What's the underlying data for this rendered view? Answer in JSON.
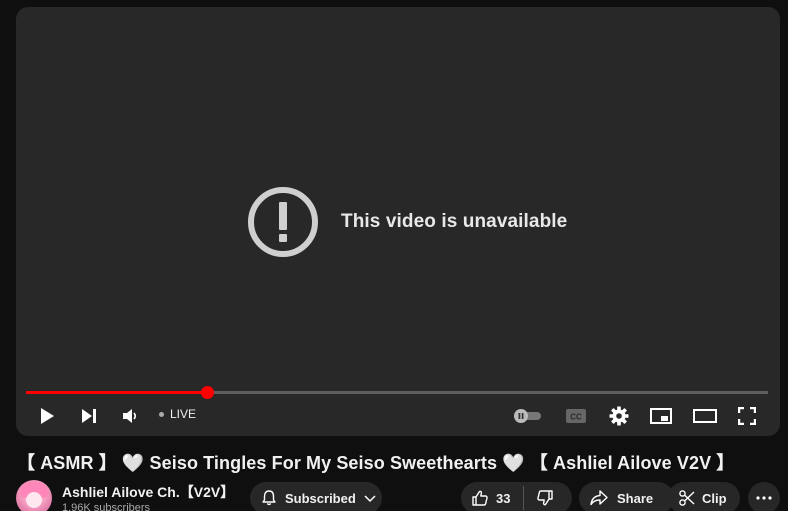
{
  "player": {
    "error_message": "This video is unavailable",
    "progress_fraction": 0.244,
    "live_label": "LIVE",
    "accent_color": "#ff0000"
  },
  "video": {
    "title": "【 ASMR 】 🤍 Seiso Tingles For My Seiso Sweethearts 🤍 【 Ashliel Ailove V2V 】"
  },
  "channel": {
    "name": "Ashliel Ailove Ch.【V2V】",
    "subscribers": "1.96K subscribers"
  },
  "actions": {
    "subscribed_label": "Subscribed",
    "like_count": "33",
    "share_label": "Share",
    "clip_label": "Clip"
  },
  "icons": [
    "alert-icon",
    "play-icon",
    "next-icon",
    "volume-icon",
    "autoplay-toggle",
    "captions-icon",
    "settings-icon",
    "miniplayer-icon",
    "theater-icon",
    "fullscreen-icon",
    "bell-icon",
    "chevron-down-icon",
    "like-icon",
    "dislike-icon",
    "share-icon",
    "scissors-icon",
    "more-icon"
  ]
}
